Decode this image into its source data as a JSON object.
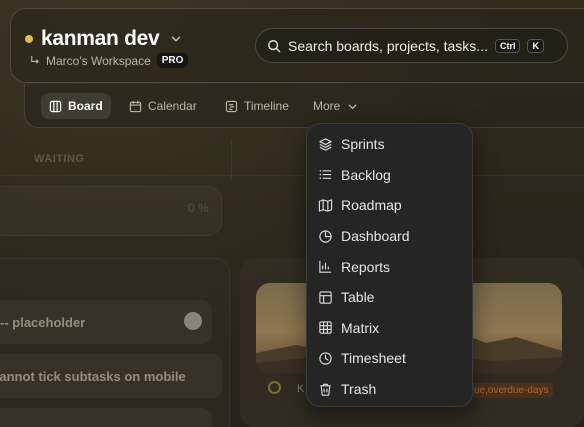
{
  "header": {
    "project_title": "kanman dev",
    "workspace": "Marco's Workspace",
    "plan_badge": "PRO"
  },
  "search": {
    "placeholder": "Search boards, projects, tasks...",
    "shortcut_ctrl": "Ctrl",
    "shortcut_key": "K"
  },
  "tabs": [
    {
      "label": "Board",
      "icon": "columns-icon",
      "active": true
    },
    {
      "label": "Calendar",
      "icon": "calendar-icon",
      "active": false
    },
    {
      "label": "Timeline",
      "icon": "timeline-icon",
      "active": false
    },
    {
      "label": "More",
      "icon": "chevron-down-icon",
      "active": false
    }
  ],
  "board": {
    "column_label": "WAITING",
    "progress_text": "0 %",
    "tasks": [
      "-- placeholder",
      "Cannot tick subtasks on mobile"
    ],
    "overdue_tag": "ue,overdue-days",
    "card_prefix": "K"
  },
  "more_menu": {
    "items": [
      {
        "label": "Sprints",
        "icon": "layers-icon"
      },
      {
        "label": "Backlog",
        "icon": "list-icon"
      },
      {
        "label": "Roadmap",
        "icon": "map-icon"
      },
      {
        "label": "Dashboard",
        "icon": "pie-chart-icon"
      },
      {
        "label": "Reports",
        "icon": "bar-chart-icon"
      },
      {
        "label": "Table",
        "icon": "table-icon"
      },
      {
        "label": "Matrix",
        "icon": "grid-icon"
      },
      {
        "label": "Timesheet",
        "icon": "clock-icon"
      },
      {
        "label": "Trash",
        "icon": "trash-icon"
      }
    ]
  },
  "colors": {
    "accent_dot": "#e8b84a",
    "menu_bg": "#252525",
    "page_bg": "#2a2518"
  }
}
